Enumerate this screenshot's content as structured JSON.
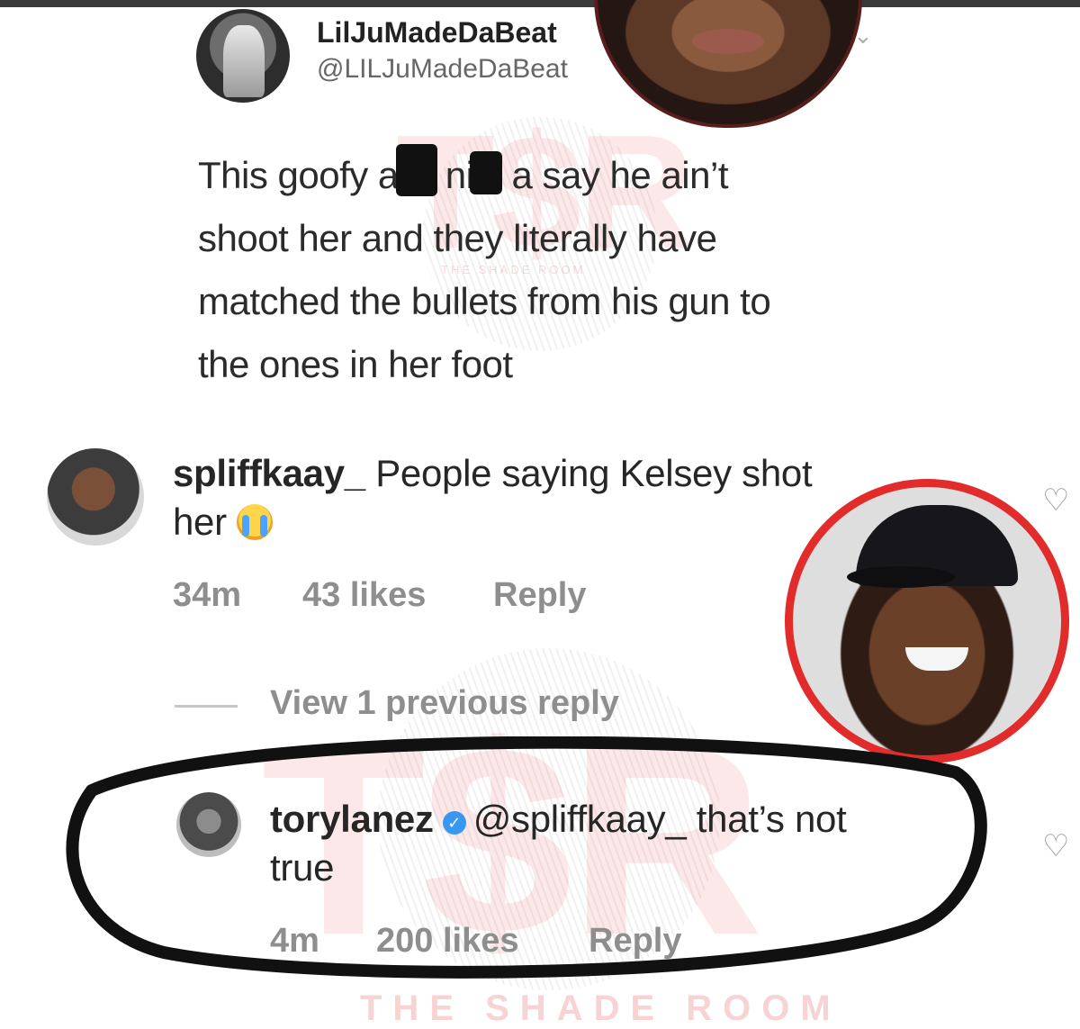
{
  "tweet": {
    "display_name": "LilJuMadeDaBeat",
    "handle": "@LILJuMadeDaBeat",
    "text": "This goofy as█ ni██a say he ain’t\nshoot her and they literally have\nmatched the bullets from his gun to\nthe ones in her foot",
    "line1_a": "This goofy a",
    "line1_b": "ni",
    "line1_c": "a say he ain’t",
    "line2": "shoot her and they literally have",
    "line3": "matched the bullets from his gun to",
    "line4": "the ones in her foot"
  },
  "watermark": {
    "sub": "THE SHADE ROOM",
    "bottom": "THE SHADE ROOM"
  },
  "comments": [
    {
      "username": "spliffkaay_",
      "text": "People saying Kelsey shot",
      "text_line2": "her",
      "time": "34m",
      "likes": "43 likes",
      "reply": "Reply"
    },
    {
      "username": "torylanez",
      "mention": "@spliffkaay_",
      "text": "that’s not",
      "text_line2": "true",
      "time": "4m",
      "likes": "200 likes",
      "reply": "Reply"
    }
  ],
  "view_replies": "View 1 previous reply",
  "colors": {
    "verified": "#3897f0",
    "annotation_circle": "#e22b2b",
    "meta_text": "#8e8e8e"
  }
}
